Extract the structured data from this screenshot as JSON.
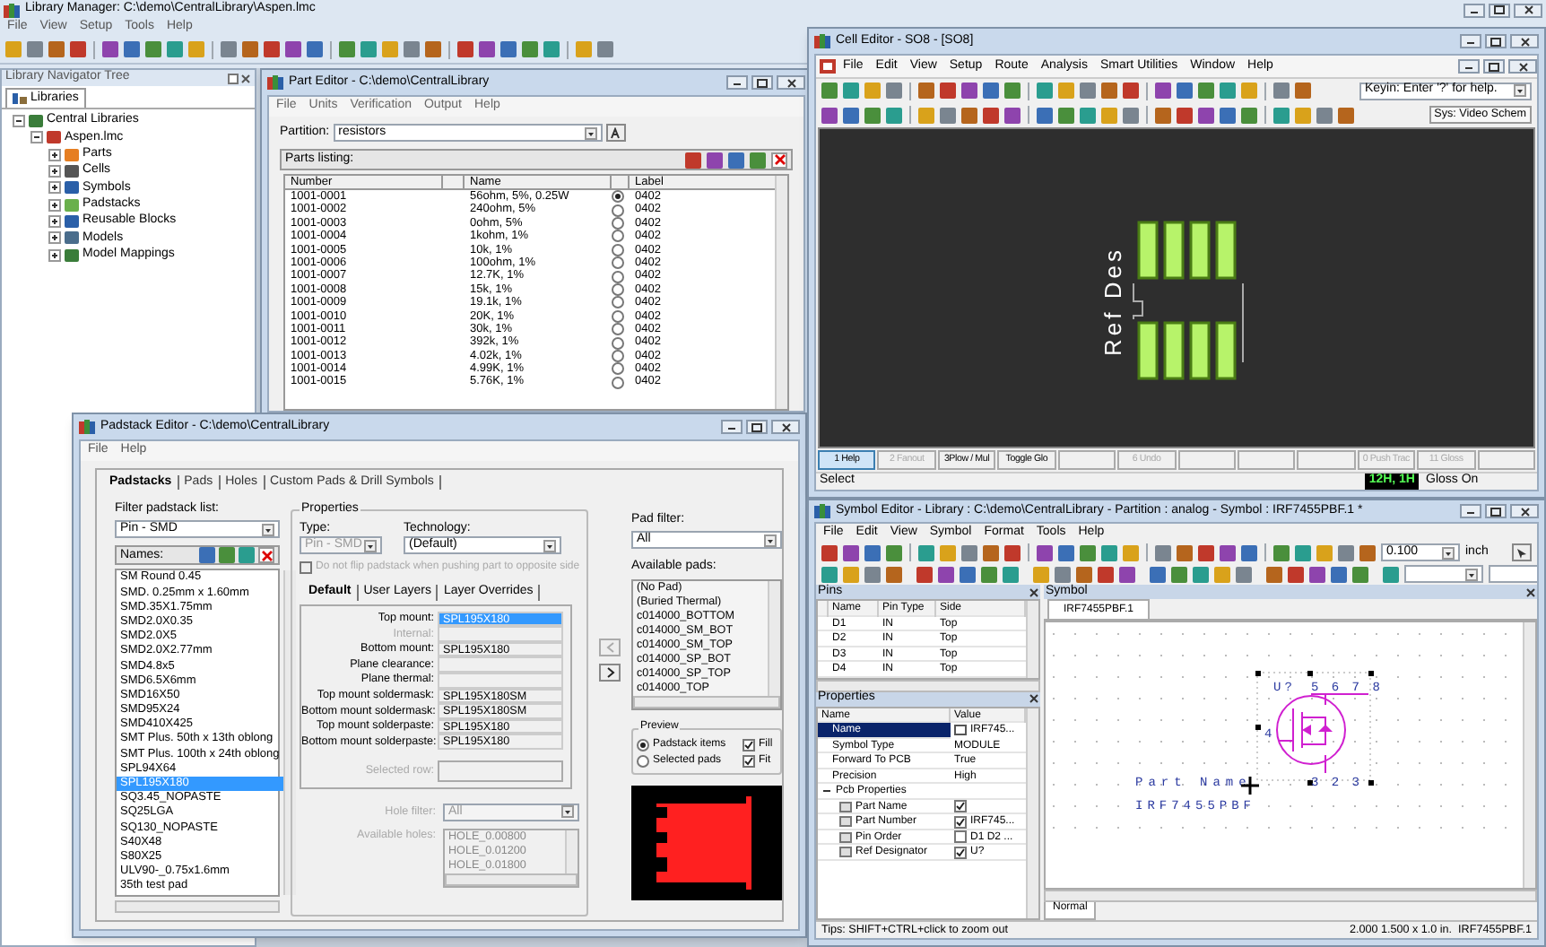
{
  "library_manager": {
    "title": "Library Manager: C:\\demo\\CentralLibrary\\Aspen.lmc",
    "menu": [
      "File",
      "View",
      "Setup",
      "Tools",
      "Help"
    ],
    "navigator": {
      "title": "Library Navigator Tree",
      "tab": {
        "label": "Libraries",
        "selected": true
      },
      "tree": [
        {
          "label": "Central Libraries",
          "expanded": true,
          "children": [
            {
              "label": "Aspen.lmc",
              "expanded": true,
              "children": [
                {
                  "label": "Parts",
                  "expanded": false
                },
                {
                  "label": "Cells",
                  "expanded": false
                },
                {
                  "label": "Symbols",
                  "expanded": false
                },
                {
                  "label": "Padstacks",
                  "expanded": false
                },
                {
                  "label": "Reusable Blocks",
                  "expanded": false
                },
                {
                  "label": "Models",
                  "expanded": false
                },
                {
                  "label": "Model Mappings",
                  "expanded": false
                }
              ]
            }
          ]
        }
      ]
    }
  },
  "part_editor": {
    "title": "Part Editor - C:\\demo\\CentralLibrary",
    "menu": [
      "File",
      "Units",
      "Verification",
      "Output",
      "Help"
    ],
    "partition_label": "Partition:",
    "partition": "resistors",
    "listing_label": "Parts listing:",
    "columns": [
      "Number",
      "Name",
      "Label"
    ],
    "rows": [
      {
        "number": "1001-0001",
        "name": "56ohm, 5%, 0.25W",
        "selected": true,
        "label": "0402"
      },
      {
        "number": "1001-0002",
        "name": "240ohm, 5%",
        "selected": false,
        "label": "0402"
      },
      {
        "number": "1001-0003",
        "name": "0ohm, 5%",
        "selected": false,
        "label": "0402"
      },
      {
        "number": "1001-0004",
        "name": "1kohm, 1%",
        "selected": false,
        "label": "0402"
      },
      {
        "number": "1001-0005",
        "name": "10k, 1%",
        "selected": false,
        "label": "0402"
      },
      {
        "number": "1001-0006",
        "name": "100ohm, 1%",
        "selected": false,
        "label": "0402"
      },
      {
        "number": "1001-0007",
        "name": "12.7K, 1%",
        "selected": false,
        "label": "0402"
      },
      {
        "number": "1001-0008",
        "name": "15k, 1%",
        "selected": false,
        "label": "0402"
      },
      {
        "number": "1001-0009",
        "name": "19.1k, 1%",
        "selected": false,
        "label": "0402"
      },
      {
        "number": "1001-0010",
        "name": "20K, 1%",
        "selected": false,
        "label": "0402"
      },
      {
        "number": "1001-0011",
        "name": "30k, 1%",
        "selected": false,
        "label": "0402"
      },
      {
        "number": "1001-0012",
        "name": "392k, 1%",
        "selected": false,
        "label": "0402"
      },
      {
        "number": "1001-0013",
        "name": "4.02k, 1%",
        "selected": false,
        "label": "0402"
      },
      {
        "number": "1001-0014",
        "name": "4.99K, 1%",
        "selected": false,
        "label": "0402"
      },
      {
        "number": "1001-0015",
        "name": "5.76K, 1%",
        "selected": false,
        "label": "0402"
      }
    ]
  },
  "padstack_editor": {
    "title": "Padstack Editor - C:\\demo\\CentralLibrary",
    "menu": [
      "File",
      "Help"
    ],
    "tabs": [
      {
        "label": "Padstacks",
        "selected": true
      },
      {
        "label": "Pads",
        "selected": false
      },
      {
        "label": "Holes",
        "selected": false
      },
      {
        "label": "Custom Pads & Drill Symbols",
        "selected": false
      }
    ],
    "filter_label": "Filter padstack list:",
    "filter": "Pin - SMD",
    "names_label": "Names:",
    "names": [
      {
        "label": "SM Round 0.45",
        "selected": false
      },
      {
        "label": "SMD. 0.25mm x 1.60mm",
        "selected": false
      },
      {
        "label": "SMD.35X1.75mm",
        "selected": false
      },
      {
        "label": "SMD2.0X0.35",
        "selected": false
      },
      {
        "label": "SMD2.0X5",
        "selected": false
      },
      {
        "label": "SMD2.0X2.77mm",
        "selected": false
      },
      {
        "label": "SMD4.8x5",
        "selected": false
      },
      {
        "label": "SMD6.5X6mm",
        "selected": false
      },
      {
        "label": "SMD16X50",
        "selected": false
      },
      {
        "label": "SMD95X24",
        "selected": false
      },
      {
        "label": "SMD410X425",
        "selected": false
      },
      {
        "label": "SMT Plus. 50th x 13th oblong",
        "selected": false
      },
      {
        "label": "SMT Plus. 100th x 24th oblong",
        "selected": false
      },
      {
        "label": "SPL94X64",
        "selected": false
      },
      {
        "label": "SPL195X180",
        "selected": true
      },
      {
        "label": "SQ3.45_NOPASTE",
        "selected": false
      },
      {
        "label": "SQ25LGA",
        "selected": false
      },
      {
        "label": "SQ130_NOPASTE",
        "selected": false
      },
      {
        "label": "S40X48",
        "selected": false
      },
      {
        "label": "S80X25",
        "selected": false
      },
      {
        "label": "ULV90-_0.75x1.6mm",
        "selected": false
      },
      {
        "label": "35th test pad",
        "selected": false
      }
    ],
    "properties": {
      "title": "Properties",
      "type_label": "Type:",
      "type": "Pin - SMD",
      "technology_label": "Technology:",
      "technology": "(Default)",
      "no_flip": {
        "label": "Do not flip padstack when pushing part to opposite side",
        "checked": false,
        "disabled": true
      },
      "tabs": [
        {
          "label": "Default",
          "selected": true
        },
        {
          "label": "User Layers",
          "selected": false
        },
        {
          "label": "Layer Overrides",
          "selected": false
        }
      ],
      "rows": [
        {
          "label": "Top mount:",
          "value": "SPL195X180",
          "selected": true,
          "disabled": false
        },
        {
          "label": "Internal:",
          "selected": false,
          "disabled": true
        },
        {
          "label": "Bottom mount:",
          "value": "SPL195X180",
          "selected": false,
          "disabled": false
        },
        {
          "label": "Plane clearance:",
          "selected": false,
          "disabled": false
        },
        {
          "label": "Plane thermal:",
          "selected": false,
          "disabled": false
        },
        {
          "label": "Top mount soldermask:",
          "value": "SPL195X180SM",
          "selected": false,
          "disabled": false
        },
        {
          "label": "Bottom mount soldermask:",
          "value": "SPL195X180SM",
          "selected": false,
          "disabled": false
        },
        {
          "label": "Top mount solderpaste:",
          "value": "SPL195X180",
          "selected": false,
          "disabled": false
        },
        {
          "label": "Bottom mount solderpaste:",
          "value": "SPL195X180",
          "selected": false,
          "disabled": false
        }
      ],
      "selected_row_label": "Selected row:",
      "hole_filter_label": "Hole filter:",
      "hole_filter": "All",
      "holes_label": "Available holes:",
      "holes": [
        "HOLE_0.00800",
        "HOLE_0.01200",
        "HOLE_0.01800"
      ]
    },
    "pad_filter_label": "Pad filter:",
    "pad_filter": "All",
    "pads_label": "Available pads:",
    "pads": [
      "(No Pad)",
      "(Buried Thermal)",
      "c014000_BOTTOM",
      "c014000_SM_BOT",
      "c014000_SM_TOP",
      "c014000_SP_BOT",
      "c014000_SP_TOP",
      "c014000_TOP"
    ],
    "preview": {
      "title": "Preview",
      "options": [
        {
          "label": "Padstack items",
          "selected": true
        },
        {
          "label": "Selected pads",
          "selected": false
        }
      ],
      "checks": [
        {
          "label": "Fill",
          "checked": true
        },
        {
          "label": "Fit",
          "checked": true
        }
      ]
    }
  },
  "cell_editor": {
    "title": "Cell Editor - SO8 - [SO8]",
    "menu": [
      "File",
      "Edit",
      "View",
      "Setup",
      "Route",
      "Analysis",
      "Smart Utilities",
      "Window",
      "Help"
    ],
    "keyin": "Keyin: Enter '?' for help.",
    "scheme_button": "Sys: Video Schem",
    "ref_des": "Ref Des",
    "function_keys": [
      {
        "label": "1 Help",
        "active": true,
        "disabled": false
      },
      {
        "label": "2 Fanout",
        "active": false,
        "disabled": true
      },
      {
        "label": "3Plow / Mul",
        "active": false,
        "disabled": false
      },
      {
        "label": "Toggle Glo",
        "active": false,
        "disabled": false
      },
      {
        "active": false
      },
      {
        "label": "6 Undo",
        "active": false,
        "disabled": true
      },
      {
        "active": false
      },
      {
        "active": false
      },
      {
        "active": false
      },
      {
        "label": "0 Push Trac",
        "active": false,
        "disabled": true
      },
      {
        "label": "11 Gloss",
        "active": false,
        "disabled": true
      },
      {
        "active": false
      }
    ],
    "status": "Select",
    "grid_readout": "12H, 1H",
    "gloss": "Gloss On"
  },
  "symbol_editor": {
    "title": "Symbol Editor - Library : C:\\demo\\CentralLibrary - Partition : analog - Symbol : IRF7455PBF.1 *",
    "menu": [
      "File",
      "Edit",
      "View",
      "Symbol",
      "Format",
      "Tools",
      "Help"
    ],
    "grid": "0.100",
    "unit": "inch",
    "pins": {
      "title": "Pins",
      "columns": [
        "Name",
        "Pin Type",
        "Side"
      ],
      "rows": [
        [
          "D1",
          "IN",
          "Top"
        ],
        [
          "D2",
          "IN",
          "Top"
        ],
        [
          "D3",
          "IN",
          "Top"
        ],
        [
          "D4",
          "IN",
          "Top"
        ]
      ]
    },
    "properties": {
      "title": "Properties",
      "columns": [
        "Name",
        "Value"
      ],
      "rows": [
        {
          "kind": "plain",
          "name": "Name",
          "value": "IRF745...",
          "selected": true
        },
        {
          "kind": "plain",
          "name": "Symbol Type",
          "value": "MODULE",
          "selected": false
        },
        {
          "kind": "plain",
          "name": "Forward To PCB",
          "value": "True",
          "selected": false
        },
        {
          "kind": "plain",
          "name": "Precision",
          "value": "High",
          "selected": false
        },
        {
          "kind": "group",
          "name": "Pcb Properties",
          "expanded": true,
          "selected": false,
          "children": [
            {
              "kind": "flag",
              "name": "Part Name",
              "checked": true,
              "selected": false
            },
            {
              "kind": "flag",
              "name": "Part Number",
              "checked": true,
              "value": "IRF745...",
              "selected": false
            },
            {
              "kind": "flag",
              "name": "Pin Order",
              "checked": false,
              "value": "D1 D2 ...",
              "selected": false
            },
            {
              "kind": "flag",
              "name": "Ref Designator",
              "checked": true,
              "value": "U?",
              "selected": false
            }
          ]
        }
      ]
    },
    "panel_title": "Symbol",
    "doc_tab": "IRF7455PBF.1",
    "canvas": {
      "ref": "U?",
      "top_pins": "5 6 7 8",
      "left_pin": "4",
      "bottom_pins": "3 2 3",
      "part_name": "Part Name",
      "part_number": "IRF7455PBF"
    },
    "view_tab": "Normal",
    "tip": "Tips: SHIFT+CTRL+click to zoom out",
    "readout": "2.000 1.500 x 1.0 in.  IRF7455PBF.1"
  }
}
